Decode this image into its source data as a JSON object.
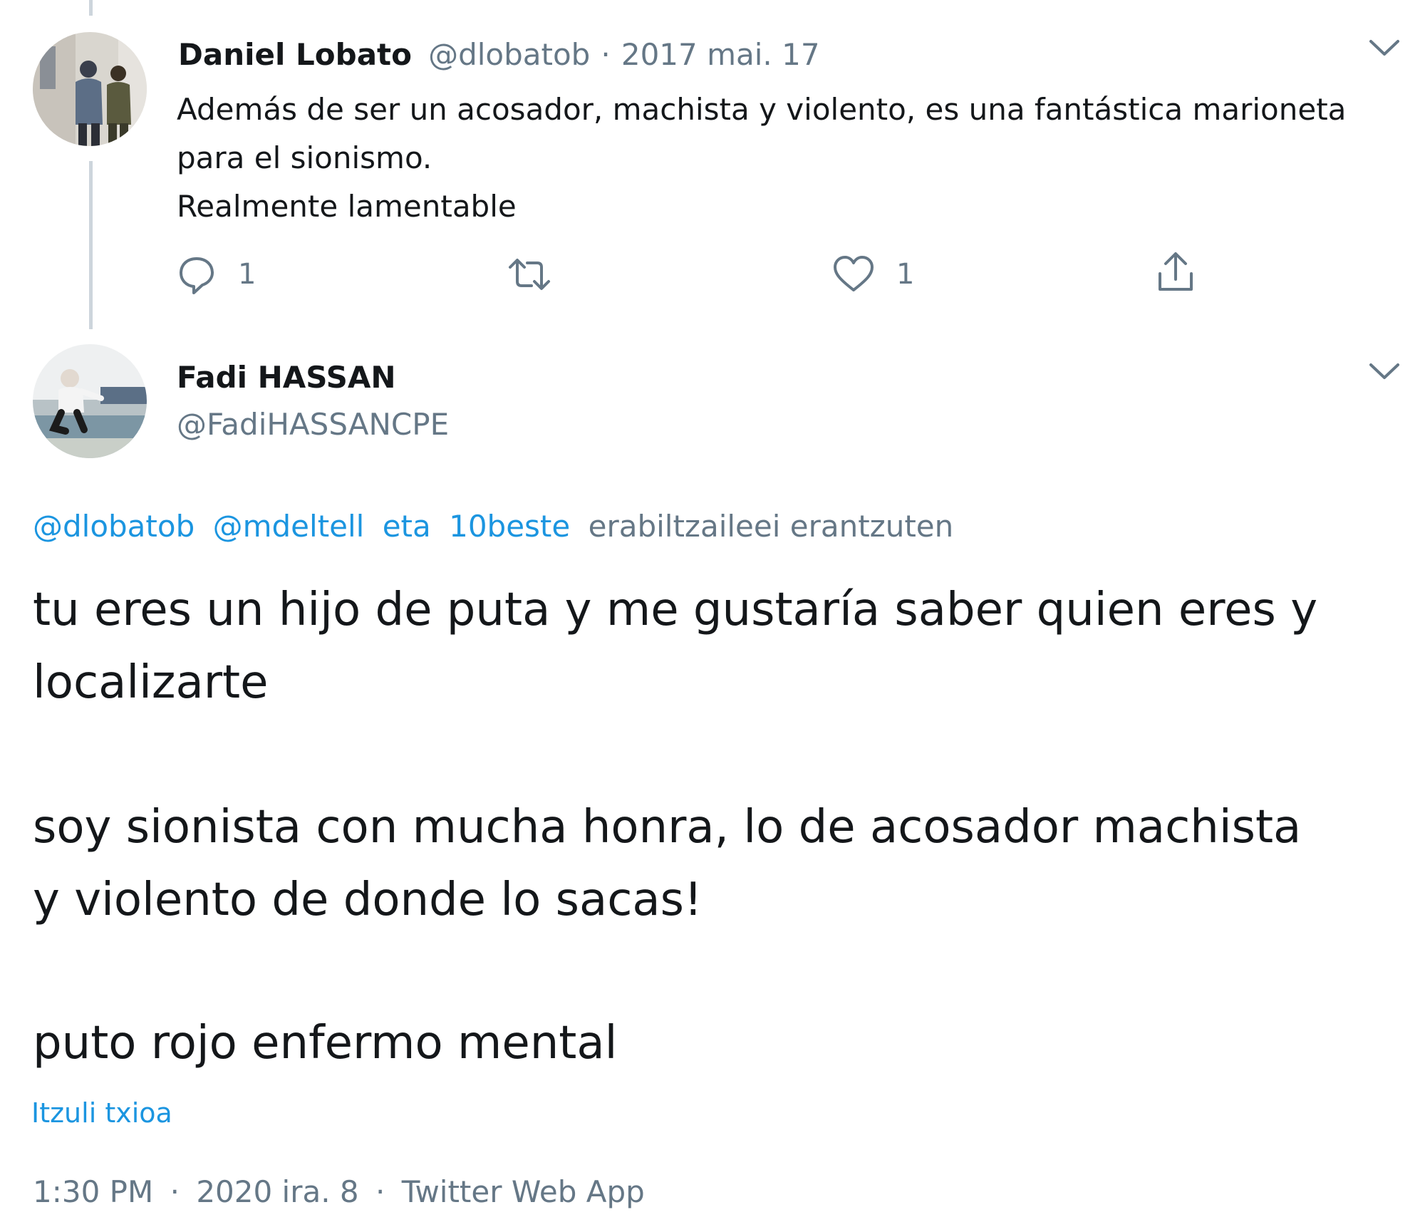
{
  "tweet1": {
    "display_name": "Daniel Lobato",
    "handle": "@dlobatob",
    "separator": "·",
    "date": "2017 mai. 17",
    "lines": [
      "Además de ser un acosador, machista y violento, es una fantástica marioneta",
      "para el sionismo.",
      "Realmente lamentable"
    ],
    "actions": {
      "reply_count": "1",
      "retweet_count": "",
      "like_count": "1"
    },
    "icons": {
      "reply": "comment-bubble-icon",
      "retweet": "retweet-arrows-icon",
      "like": "heart-icon",
      "share": "share-upload-icon",
      "menu": "chevron-down-icon"
    }
  },
  "tweet2": {
    "display_name": "Fadi HASSAN",
    "handle": "@FadiHASSANCPE",
    "reply_to": {
      "mention1": "@dlobatob",
      "mention2": "@mdeltell",
      "conjunction": "eta",
      "others": "10beste",
      "suffix": "erabiltzaileei erantzuten"
    },
    "paragraphs": [
      "tu eres un hijo de puta y me gustaría saber quien eres y",
      "localizarte",
      "soy sionista con mucha honra, lo de acosador machista",
      "y violento de donde lo sacas!",
      "puto rojo enfermo mental"
    ],
    "translate_label": "Itzuli txioa",
    "time": "1:30 PM",
    "separator": "·",
    "date": "2020 ira. 8",
    "source": "Twitter Web App",
    "icons": {
      "menu": "chevron-down-icon"
    }
  },
  "colors": {
    "text": "#14171a",
    "muted": "#657786",
    "link": "#1b95e0",
    "thread_line": "#cdd5dc"
  }
}
